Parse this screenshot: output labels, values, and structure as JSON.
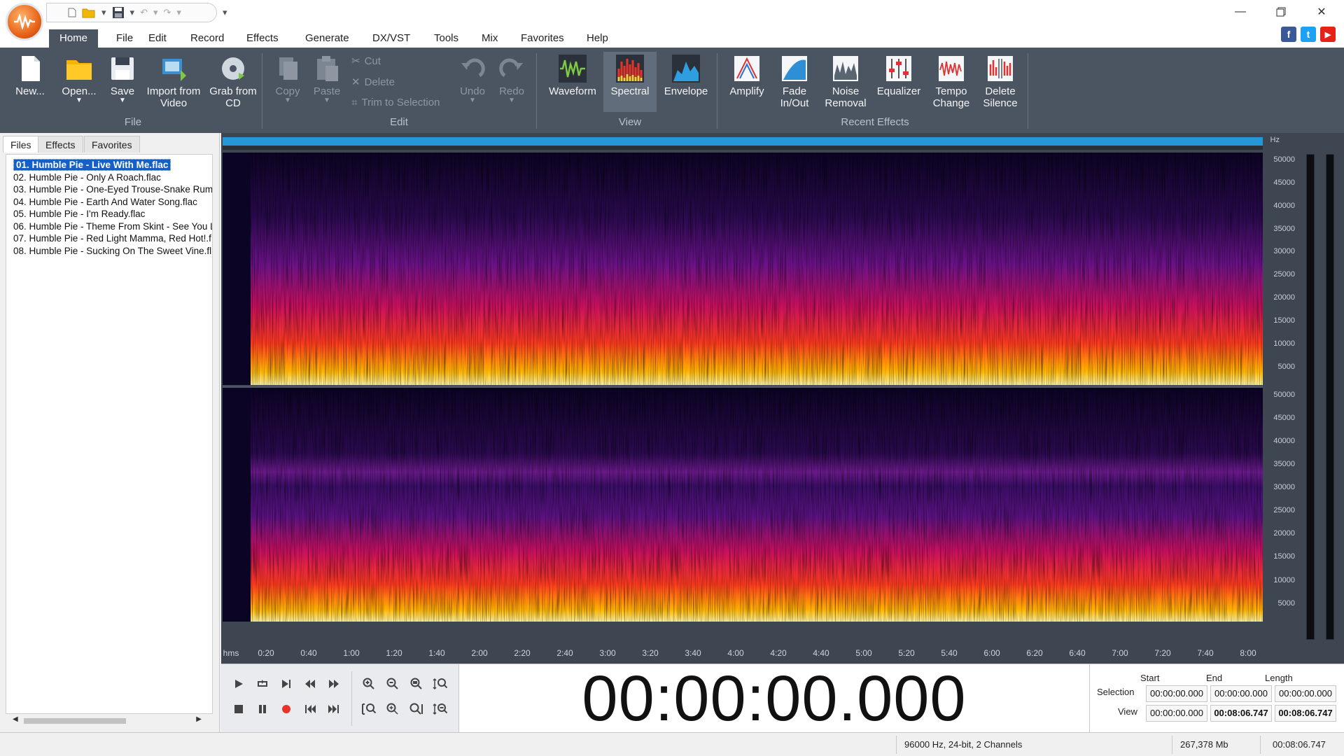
{
  "titlebar": {
    "qat_icons": [
      "new-icon",
      "open-folder-icon",
      "save-icon",
      "undo-icon",
      "redo-icon",
      "customize-icon"
    ],
    "window_controls": [
      "minimize",
      "restore",
      "close"
    ]
  },
  "menu": {
    "tabs": [
      "Home",
      "File",
      "Edit",
      "Record",
      "Effects",
      "Generate",
      "DX/VST",
      "Tools",
      "Mix",
      "Favorites",
      "Help"
    ],
    "active": "Home"
  },
  "social": [
    "f",
    "t",
    "▶"
  ],
  "ribbon": {
    "file": {
      "label": "File",
      "new": "New...",
      "open": "Open...",
      "save": "Save",
      "import_video": "Import from Video",
      "grab_cd": "Grab from CD"
    },
    "edit": {
      "label": "Edit",
      "copy": "Copy",
      "paste": "Paste",
      "cut": "Cut",
      "delete": "Delete",
      "trim": "Trim to Selection",
      "undo": "Undo",
      "redo": "Redo"
    },
    "view": {
      "label": "View",
      "waveform": "Waveform",
      "spectral": "Spectral",
      "envelope": "Envelope",
      "active": "Spectral"
    },
    "recent_effects": {
      "label": "Recent Effects",
      "amplify": "Amplify",
      "fade": "Fade In/Out",
      "noise": "Noise Removal",
      "equalizer": "Equalizer",
      "tempo": "Tempo Change",
      "delete_silence": "Delete Silence"
    }
  },
  "left_panel": {
    "tabs": [
      "Files",
      "Effects",
      "Favorites"
    ],
    "active_tab": "Files",
    "files": [
      "01. Humble Pie - Live With Me.flac",
      "02. Humble Pie - Only A Roach.flac",
      "03. Humble Pie - One-Eyed Trouse-Snake Rum",
      "04. Humble Pie - Earth And Water Song.flac",
      "05. Humble Pie - I'm Ready.flac",
      "06. Humble Pie - Theme From Skint - See You L",
      "07. Humble Pie - Red Light Mamma, Red Hot!.f",
      "08. Humble Pie - Sucking On The Sweet Vine.fl"
    ],
    "selected_index": 0
  },
  "spectrogram": {
    "hz_unit": "Hz",
    "hz_ticks": [
      "50000",
      "45000",
      "40000",
      "35000",
      "30000",
      "25000",
      "20000",
      "15000",
      "10000",
      "5000"
    ],
    "time_unit": "hms",
    "time_ticks": [
      "0:20",
      "0:40",
      "1:00",
      "1:20",
      "1:40",
      "2:00",
      "2:20",
      "2:40",
      "3:00",
      "3:20",
      "3:40",
      "4:00",
      "4:20",
      "4:40",
      "5:00",
      "5:20",
      "5:40",
      "6:00",
      "6:20",
      "6:40",
      "7:00",
      "7:20",
      "7:40",
      "8:00"
    ]
  },
  "transport": {
    "timecode": "00:00:00.000"
  },
  "selection": {
    "headers": [
      "Start",
      "End",
      "Length"
    ],
    "selection_label": "Selection",
    "view_label": "View",
    "selection_values": [
      "00:00:00.000",
      "00:00:00.000",
      "00:00:00.000"
    ],
    "view_values": [
      "00:00:00.000",
      "00:08:06.747",
      "00:08:06.747"
    ]
  },
  "status": {
    "format": "96000 Hz, 24-bit, 2 Channels",
    "size": "267,378 Mb",
    "duration": "00:08:06.747"
  },
  "colors": {
    "ribbon_bg": "#4b5562",
    "accent_blue": "#2597d8",
    "selection_blue": "#1460c8"
  }
}
